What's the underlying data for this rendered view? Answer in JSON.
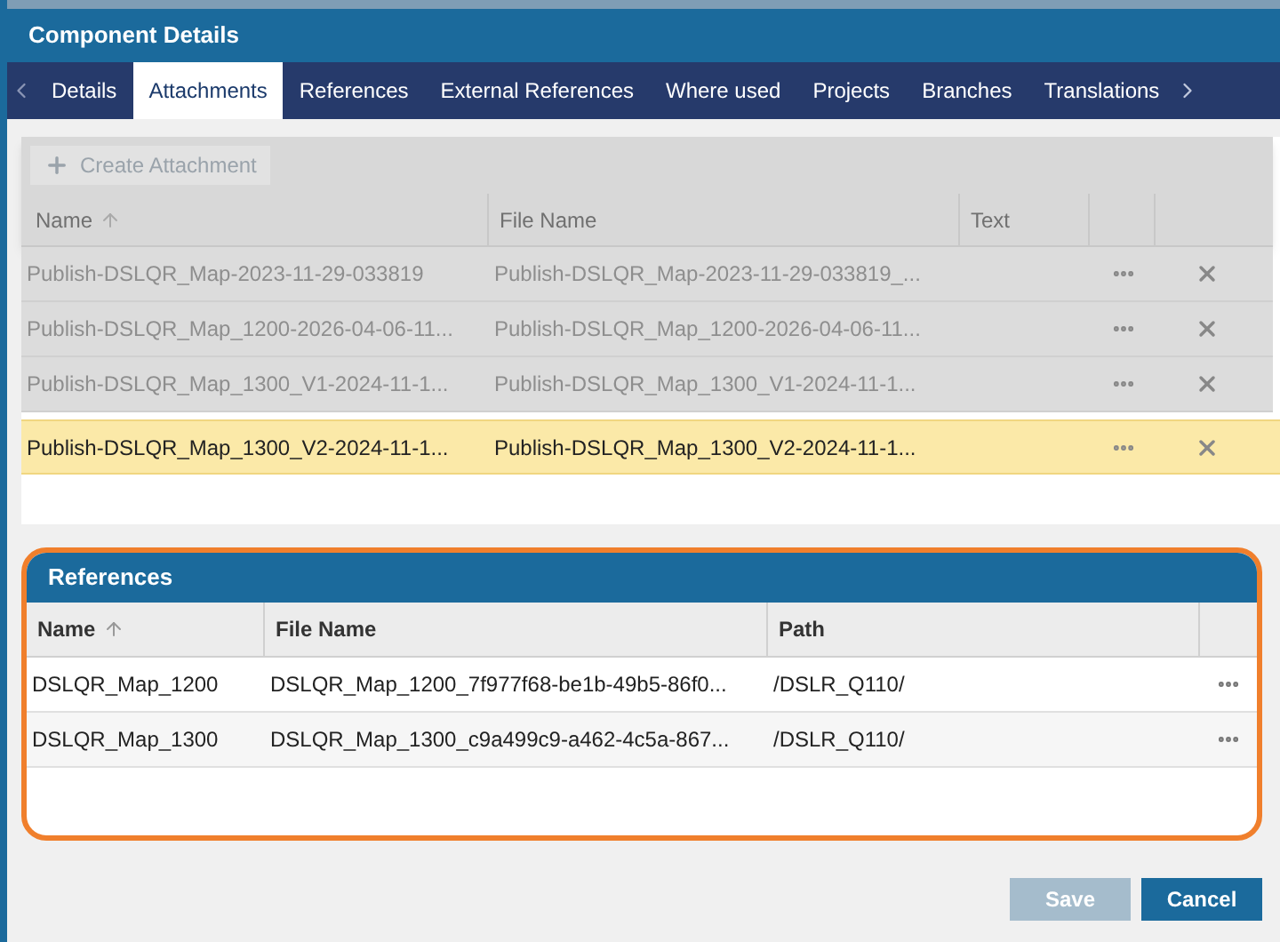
{
  "window": {
    "title": "Component Details"
  },
  "tabs": [
    {
      "label": "Details",
      "selected": false
    },
    {
      "label": "Attachments",
      "selected": true
    },
    {
      "label": "References",
      "selected": false
    },
    {
      "label": "External References",
      "selected": false
    },
    {
      "label": "Where used",
      "selected": false
    },
    {
      "label": "Projects",
      "selected": false
    },
    {
      "label": "Branches",
      "selected": false
    },
    {
      "label": "Translations",
      "selected": false
    }
  ],
  "attachments": {
    "create_button": {
      "label": "Create Attachment",
      "disabled": true
    },
    "columns": [
      "Name",
      "File Name",
      "Text"
    ],
    "rows": [
      {
        "name": "Publish-DSLQR_Map-2023-11-29-033819",
        "file_name": "Publish-DSLQR_Map-2023-11-29-033819_...",
        "selected": false
      },
      {
        "name": "Publish-DSLQR_Map_1200-2026-04-06-11...",
        "file_name": "Publish-DSLQR_Map_1200-2026-04-06-11...",
        "selected": false
      },
      {
        "name": "Publish-DSLQR_Map_1300_V1-2024-11-1...",
        "file_name": "Publish-DSLQR_Map_1300_V1-2024-11-1...",
        "selected": false
      },
      {
        "name": "Publish-DSLQR_Map_1300_V2-2024-11-1...",
        "file_name": "Publish-DSLQR_Map_1300_V2-2024-11-1...",
        "selected": true
      }
    ]
  },
  "references": {
    "title": "References",
    "columns": [
      "Name",
      "File Name",
      "Path"
    ],
    "rows": [
      {
        "name": "DSLQR_Map_1200",
        "file_name": "DSLQR_Map_1200_7f977f68-be1b-49b5-86f0...",
        "path": "/DSLR_Q110/"
      },
      {
        "name": "DSLQR_Map_1300",
        "file_name": "DSLQR_Map_1300_c9a499c9-a462-4c5a-867...",
        "path": "/DSLR_Q110/"
      }
    ]
  },
  "buttons": [
    {
      "label": "Save",
      "disabled": true
    },
    {
      "label": "Cancel",
      "disabled": false
    }
  ]
}
